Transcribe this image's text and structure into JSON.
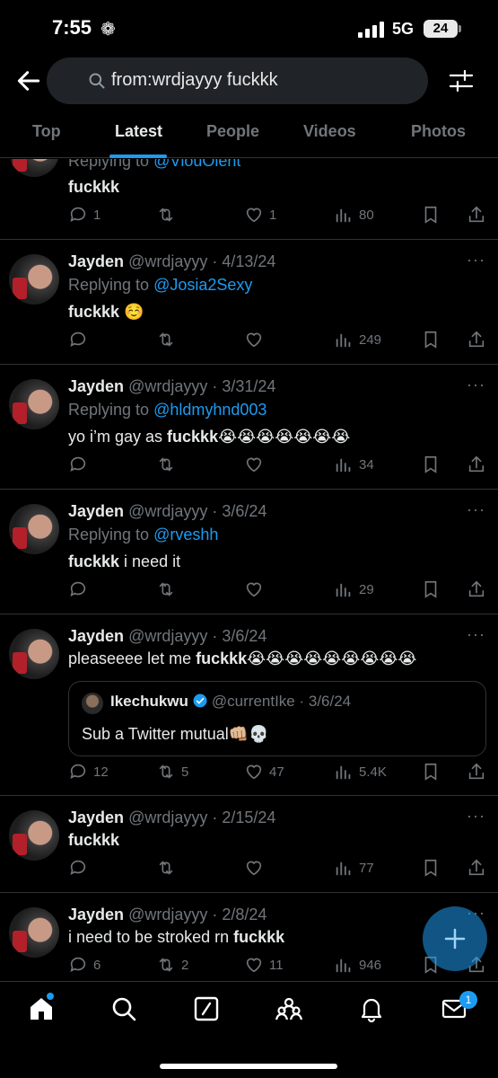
{
  "status_bar": {
    "time": "7:55",
    "network": "5G",
    "battery": "24"
  },
  "search": {
    "query": "from:wrdjayyy fuckkk"
  },
  "tabs": [
    {
      "label": "Top",
      "active": false
    },
    {
      "label": "Latest",
      "active": true
    },
    {
      "label": "People",
      "active": false
    },
    {
      "label": "Videos",
      "active": false
    },
    {
      "label": "Photos",
      "active": false
    }
  ],
  "tweets": [
    {
      "reply_prefix": "Replying to ",
      "reply_to": "@VlouOlent",
      "body": "fuckkk",
      "replies": "1",
      "retweets": "",
      "likes": "1",
      "views": "80"
    },
    {
      "name": "Jayden",
      "handle": "@wrdjayyy · 4/13/24",
      "reply_prefix": "Replying to ",
      "reply_to": "@Josia2Sexy",
      "body_bold": "fuckkk",
      "body_rest": " ☺️",
      "replies": "",
      "retweets": "",
      "likes": "",
      "views": "249"
    },
    {
      "name": "Jayden",
      "handle": "@wrdjayyy · 3/31/24",
      "reply_prefix": "Replying to ",
      "reply_to": "@hldmyhnd003",
      "body_pre": "yo i’m gay as ",
      "body_bold": "fuckkk",
      "body_rest": "😭😭😭😭😭😭😭",
      "replies": "",
      "retweets": "",
      "likes": "",
      "views": "34"
    },
    {
      "name": "Jayden",
      "handle": "@wrdjayyy · 3/6/24",
      "reply_prefix": "Replying to ",
      "reply_to": "@rveshh",
      "body_bold": "fuckkk",
      "body_rest": " i need it",
      "replies": "",
      "retweets": "",
      "likes": "",
      "views": "29"
    },
    {
      "name": "Jayden",
      "handle": "@wrdjayyy · 3/6/24",
      "body_pre": "pleaseeee let me ",
      "body_bold": "fuckkk",
      "body_rest": "😭😭😭😭😭😭😭😭😭",
      "quote": {
        "name": "Ikechukwu",
        "handle": "@currentIke · 3/6/24",
        "body": "Sub a Twitter mutual👊🏼💀"
      },
      "replies": "12",
      "retweets": "5",
      "likes": "47",
      "views": "5.4K"
    },
    {
      "name": "Jayden",
      "handle": "@wrdjayyy · 2/15/24",
      "body_bold": "fuckkk",
      "replies": "",
      "retweets": "",
      "likes": "",
      "views": "77"
    },
    {
      "name": "Jayden",
      "handle": "@wrdjayyy · 2/8/24",
      "body_pre": "i need to be stroked rn ",
      "body_bold": "fuckkk",
      "replies": "6",
      "retweets": "2",
      "likes": "11",
      "views": "946"
    }
  ],
  "more_menu": "···",
  "nav": {
    "messages_badge": "1"
  },
  "colors": {
    "accent": "#1d9bf0",
    "background": "#000000",
    "secondary_text": "#71767b",
    "divider": "#2f3336"
  }
}
